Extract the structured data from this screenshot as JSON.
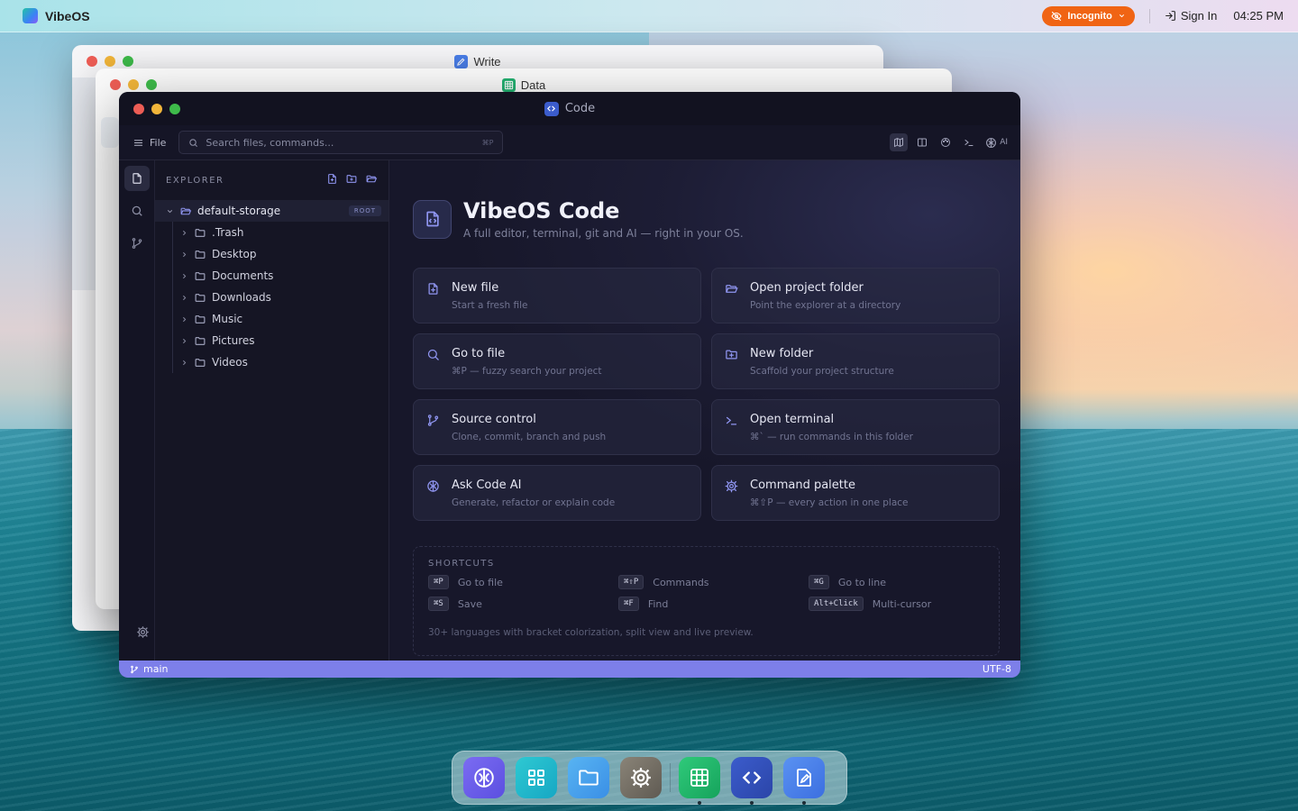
{
  "topbar": {
    "brand": "VibeOS",
    "incognito_label": "Incognito",
    "signin_label": "Sign In",
    "clock": "04:25 PM"
  },
  "windows": {
    "write_title": "Write",
    "data_title": "Data",
    "code_title": "Code"
  },
  "toolbar": {
    "file_label": "File",
    "search_placeholder": "Search files, commands...",
    "search_hint": "⌘P",
    "ai_label": "AI"
  },
  "explorer": {
    "header": "EXPLORER",
    "root_name": "default-storage",
    "root_badge": "ROOT",
    "folders": [
      ".Trash",
      "Desktop",
      "Documents",
      "Downloads",
      "Music",
      "Pictures",
      "Videos"
    ]
  },
  "hero": {
    "title": "VibeOS Code",
    "subtitle": "A full editor, terminal, git and AI — right in your OS."
  },
  "cards": [
    {
      "title": "New file",
      "desc": "Start a fresh file",
      "icon": "file-plus-icon"
    },
    {
      "title": "Open project folder",
      "desc": "Point the explorer at a directory",
      "icon": "folder-open-icon"
    },
    {
      "title": "Go to file",
      "desc": "⌘P — fuzzy search your project",
      "icon": "search-icon"
    },
    {
      "title": "New folder",
      "desc": "Scaffold your project structure",
      "icon": "folder-plus-icon"
    },
    {
      "title": "Source control",
      "desc": "Clone, commit, branch and push",
      "icon": "git-branch-icon"
    },
    {
      "title": "Open terminal",
      "desc": "⌘` — run commands in this folder",
      "icon": "terminal-icon"
    },
    {
      "title": "Ask Code AI",
      "desc": "Generate, refactor or explain code",
      "icon": "brain-icon"
    },
    {
      "title": "Command palette",
      "desc": "⌘⇧P — every action in one place",
      "icon": "gear-icon"
    }
  ],
  "shortcuts": {
    "header": "SHORTCUTS",
    "items": [
      {
        "key": "⌘P",
        "label": "Go to file"
      },
      {
        "key": "⌘⇧P",
        "label": "Commands"
      },
      {
        "key": "⌘G",
        "label": "Go to line"
      },
      {
        "key": "⌘S",
        "label": "Save"
      },
      {
        "key": "⌘F",
        "label": "Find"
      },
      {
        "key": "Alt+Click",
        "label": "Multi-cursor"
      }
    ],
    "footer": "30+ languages with bracket colorization, split view and live preview."
  },
  "statusbar": {
    "branch": "main",
    "encoding": "UTF-8"
  },
  "dock": {
    "items": [
      "brain-app",
      "apps-grid",
      "files",
      "settings",
      "data",
      "code",
      "write"
    ]
  },
  "colors": {
    "accent": "#7d7fe9",
    "incognito": "#f06414",
    "icon_tint": "#8f95f0"
  }
}
